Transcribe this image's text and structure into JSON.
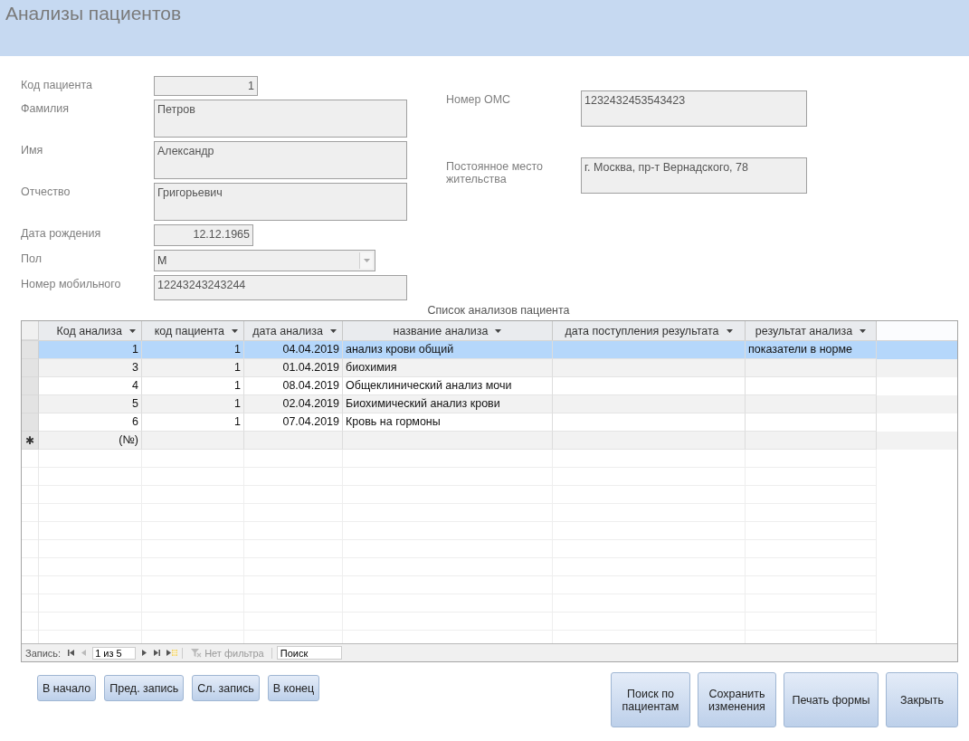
{
  "window": {
    "title": "Анализы пациентов"
  },
  "fields_left": [
    {
      "label": "Код пациента",
      "value": "1",
      "kind": "number"
    },
    {
      "label": "Фамилия",
      "value": "Петров",
      "kind": "memo"
    },
    {
      "label": "Имя",
      "value": "Александр",
      "kind": "memo"
    },
    {
      "label": "Отчество",
      "value": "Григорьевич",
      "kind": "memo"
    },
    {
      "label": "Дата рождения",
      "value": "12.12.1965",
      "kind": "date"
    },
    {
      "label": "Пол",
      "value": "М",
      "kind": "combo"
    },
    {
      "label": "Номер мобильного",
      "value": "12243243243244",
      "kind": "line"
    }
  ],
  "fields_right": [
    {
      "label": "Номер ОМС",
      "value": "1232432453543423"
    },
    {
      "label": "Постоянное место жительства",
      "value": "г. Москва, пр-т Вернадского, 78"
    }
  ],
  "subform": {
    "caption": "Список анализов пациента",
    "columns": [
      {
        "name": "Код анализа",
        "kind": "number"
      },
      {
        "name": "код пациента",
        "kind": "number"
      },
      {
        "name": "дата анализа",
        "kind": "number"
      },
      {
        "name": "название анализа",
        "kind": "text"
      },
      {
        "name": "дата поступления результата",
        "kind": "text"
      },
      {
        "name": "результат анализа",
        "kind": "text"
      }
    ],
    "rows": [
      {
        "selected": true,
        "cells": [
          "1",
          "1",
          "04.04.2019",
          "анализ крови общий",
          "",
          "показатели в норме"
        ]
      },
      {
        "selected": false,
        "cells": [
          "3",
          "1",
          "01.04.2019",
          "биохимия",
          "",
          ""
        ]
      },
      {
        "selected": false,
        "cells": [
          "4",
          "1",
          "08.04.2019",
          "Общеклинический анализ мочи",
          "",
          ""
        ]
      },
      {
        "selected": false,
        "cells": [
          "5",
          "1",
          "02.04.2019",
          "Биохимический анализ крови",
          "",
          ""
        ]
      },
      {
        "selected": false,
        "cells": [
          "6",
          "1",
          "07.04.2019",
          "Кровь на гормоны",
          "",
          ""
        ]
      }
    ],
    "new_row": {
      "marker": "✱",
      "cells": [
        "(№)",
        "",
        "",
        "",
        "",
        ""
      ]
    },
    "navigator": {
      "label": "Запись:",
      "position": "1 из 5",
      "filter": "Нет фильтра",
      "search_placeholder": "Поиск"
    }
  },
  "buttons_left": [
    "В начало",
    "Пред. запись",
    "Сл. запись",
    "В конец"
  ],
  "buttons_right": [
    "Поиск по пациентам",
    "Сохранить изменения",
    "Печать формы",
    "Закрыть"
  ]
}
